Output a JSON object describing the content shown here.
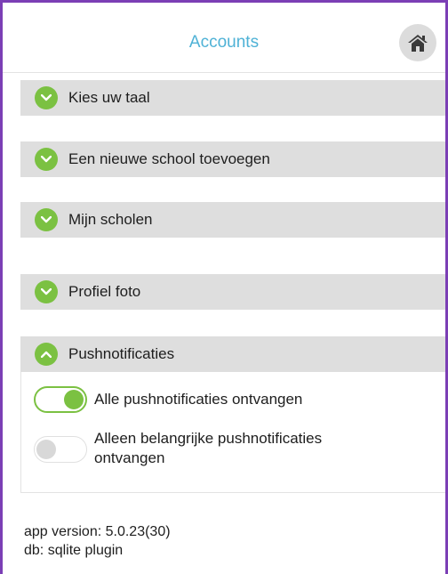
{
  "header": {
    "title": "Accounts",
    "home_icon": "home-icon"
  },
  "colors": {
    "title": "#4fb2d6",
    "accent_green": "#7bc142",
    "section_bg": "#dedede",
    "frame": "#7b3fb5"
  },
  "sections": [
    {
      "label": "Kies uw taal",
      "expanded": false,
      "icon": "chevron-down-icon"
    },
    {
      "label": "Een nieuwe school toevoegen",
      "expanded": false,
      "icon": "chevron-down-icon"
    },
    {
      "label": "Mijn scholen",
      "expanded": false,
      "icon": "chevron-down-icon"
    },
    {
      "label": "Profiel foto",
      "expanded": false,
      "icon": "chevron-down-icon"
    },
    {
      "label": "Pushnotificaties",
      "expanded": true,
      "icon": "chevron-up-icon"
    }
  ],
  "push": {
    "options": [
      {
        "label": "Alle pushnotificaties ontvangen",
        "on": true
      },
      {
        "label": "Alleen belangrijke pushnotificaties ontvangen",
        "on": false
      }
    ]
  },
  "footer": {
    "version": "app version: 5.0.23(30)",
    "db": "db: sqlite plugin"
  }
}
